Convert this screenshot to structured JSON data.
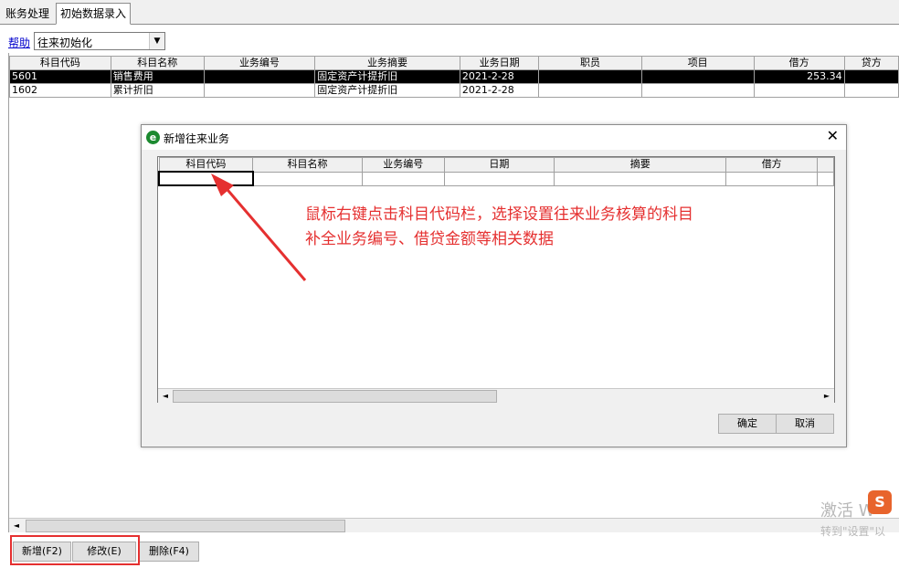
{
  "tabs": [
    "账务处理",
    "初始数据录入"
  ],
  "toolbar": {
    "help_label": "帮助",
    "combo_value": "往来初始化"
  },
  "main_grid": {
    "columns": [
      "科目代码",
      "科目名称",
      "业务编号",
      "业务摘要",
      "业务日期",
      "职员",
      "项目",
      "借方",
      "贷方"
    ],
    "rows": [
      [
        "5601",
        "销售费用",
        "",
        "固定资产计提折旧",
        "2021-2-28",
        "",
        "",
        "253.34",
        ""
      ],
      [
        "1602",
        "累计折旧",
        "",
        "固定资产计提折旧",
        "2021-2-28",
        "",
        "",
        "",
        ""
      ]
    ]
  },
  "buttons": {
    "add": "新增(F2)",
    "edit": "修改(E)",
    "delete": "删除(F4)"
  },
  "dialog": {
    "title": "新增往来业务",
    "close_glyph": "✕",
    "columns": [
      "科目代码",
      "科目名称",
      "业务编号",
      "日期",
      "摘要",
      "借方"
    ],
    "ok_label": "确定",
    "cancel_label": "取消"
  },
  "annotation": {
    "line1": "鼠标右键点击科目代码栏，选择设置往来业务核算的科目",
    "line2": "补全业务编号、借贷金额等相关数据",
    "color": "#e53030"
  },
  "watermark": {
    "line1": "激活 W",
    "line2": "转到\"设置\"以"
  },
  "icons": {
    "app_icon": "e-browser-icon",
    "combo_arrow": "▼",
    "scroll_left": "◄",
    "scroll_right": "►"
  }
}
